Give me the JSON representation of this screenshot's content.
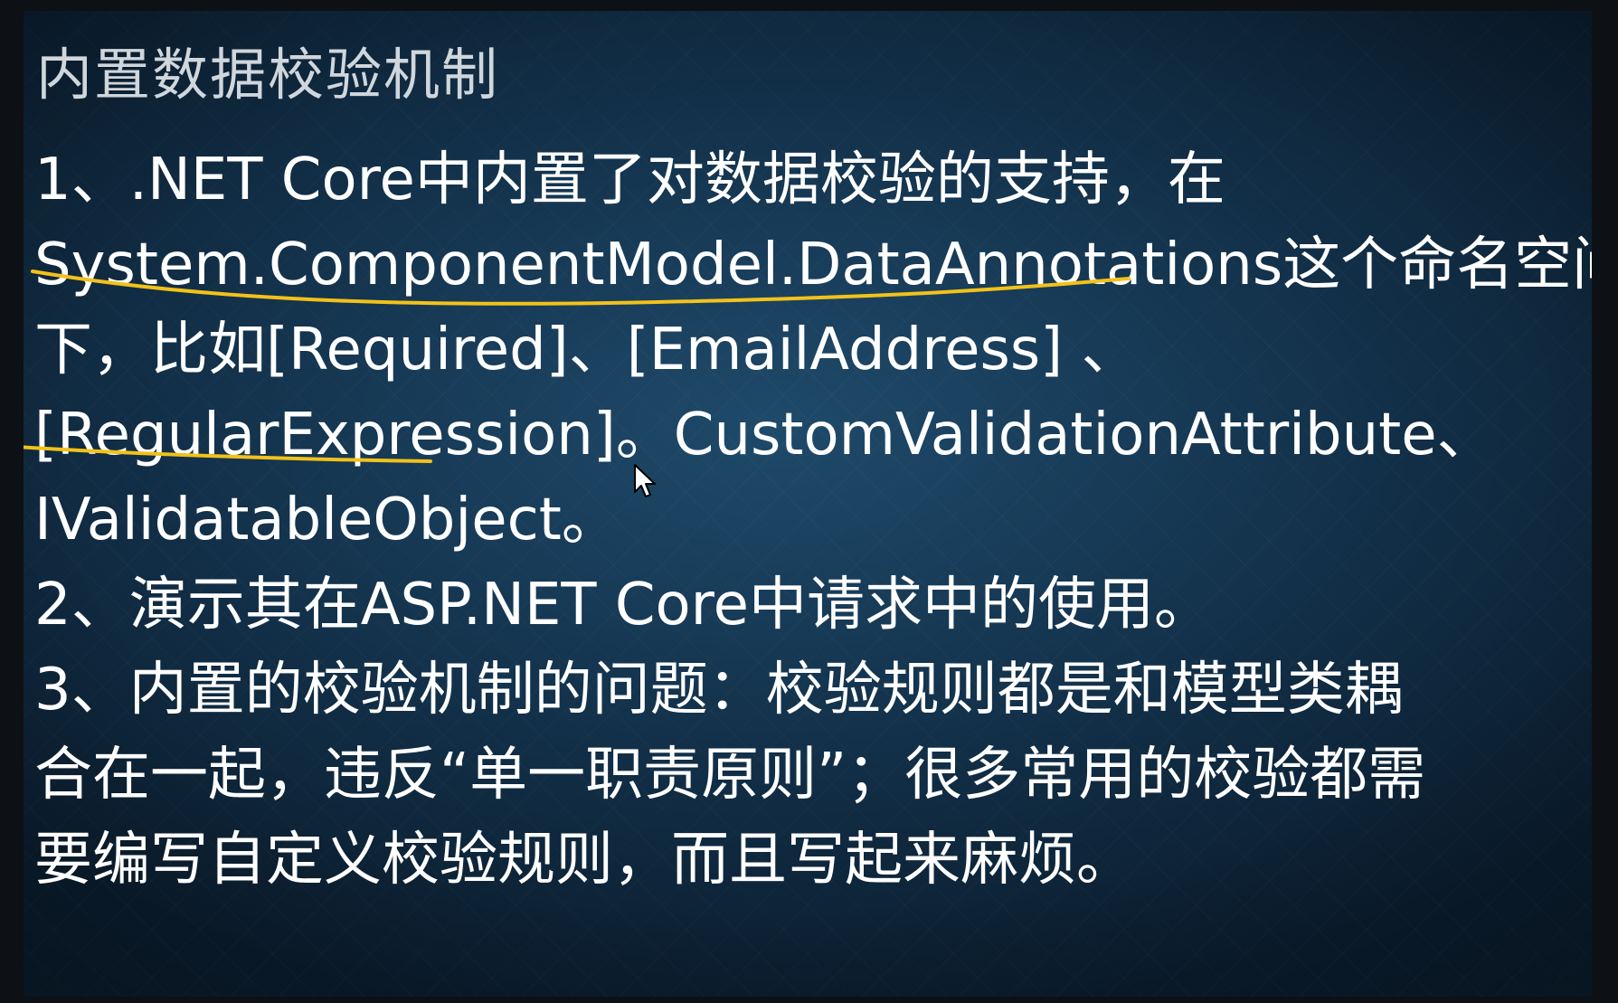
{
  "slide": {
    "title": "内置数据校验机制",
    "lines": [
      "1、.NET Core中内置了对数据校验的支持，在",
      "System.ComponentModel.DataAnnotations这个命名空间",
      "下，比如[Required]、[EmailAddress] 、",
      "[RegularExpression]。CustomValidationAttribute、",
      "IValidatableObject。",
      "2、演示其在ASP.NET Core中请求中的使用。",
      "3、内置的校验机制的问题：校验规则都是和模型类耦",
      "合在一起，违反“单一职责原则”；很多常用的校验都需",
      "要编写自定义校验规则，而且写起来麻烦。"
    ]
  },
  "colors": {
    "text": "#ffffff",
    "title": "#cfd6dc",
    "annotation": "#f2c21a",
    "background": "#173a56"
  },
  "icons": {
    "pointer": "mouse-pointer-icon"
  }
}
